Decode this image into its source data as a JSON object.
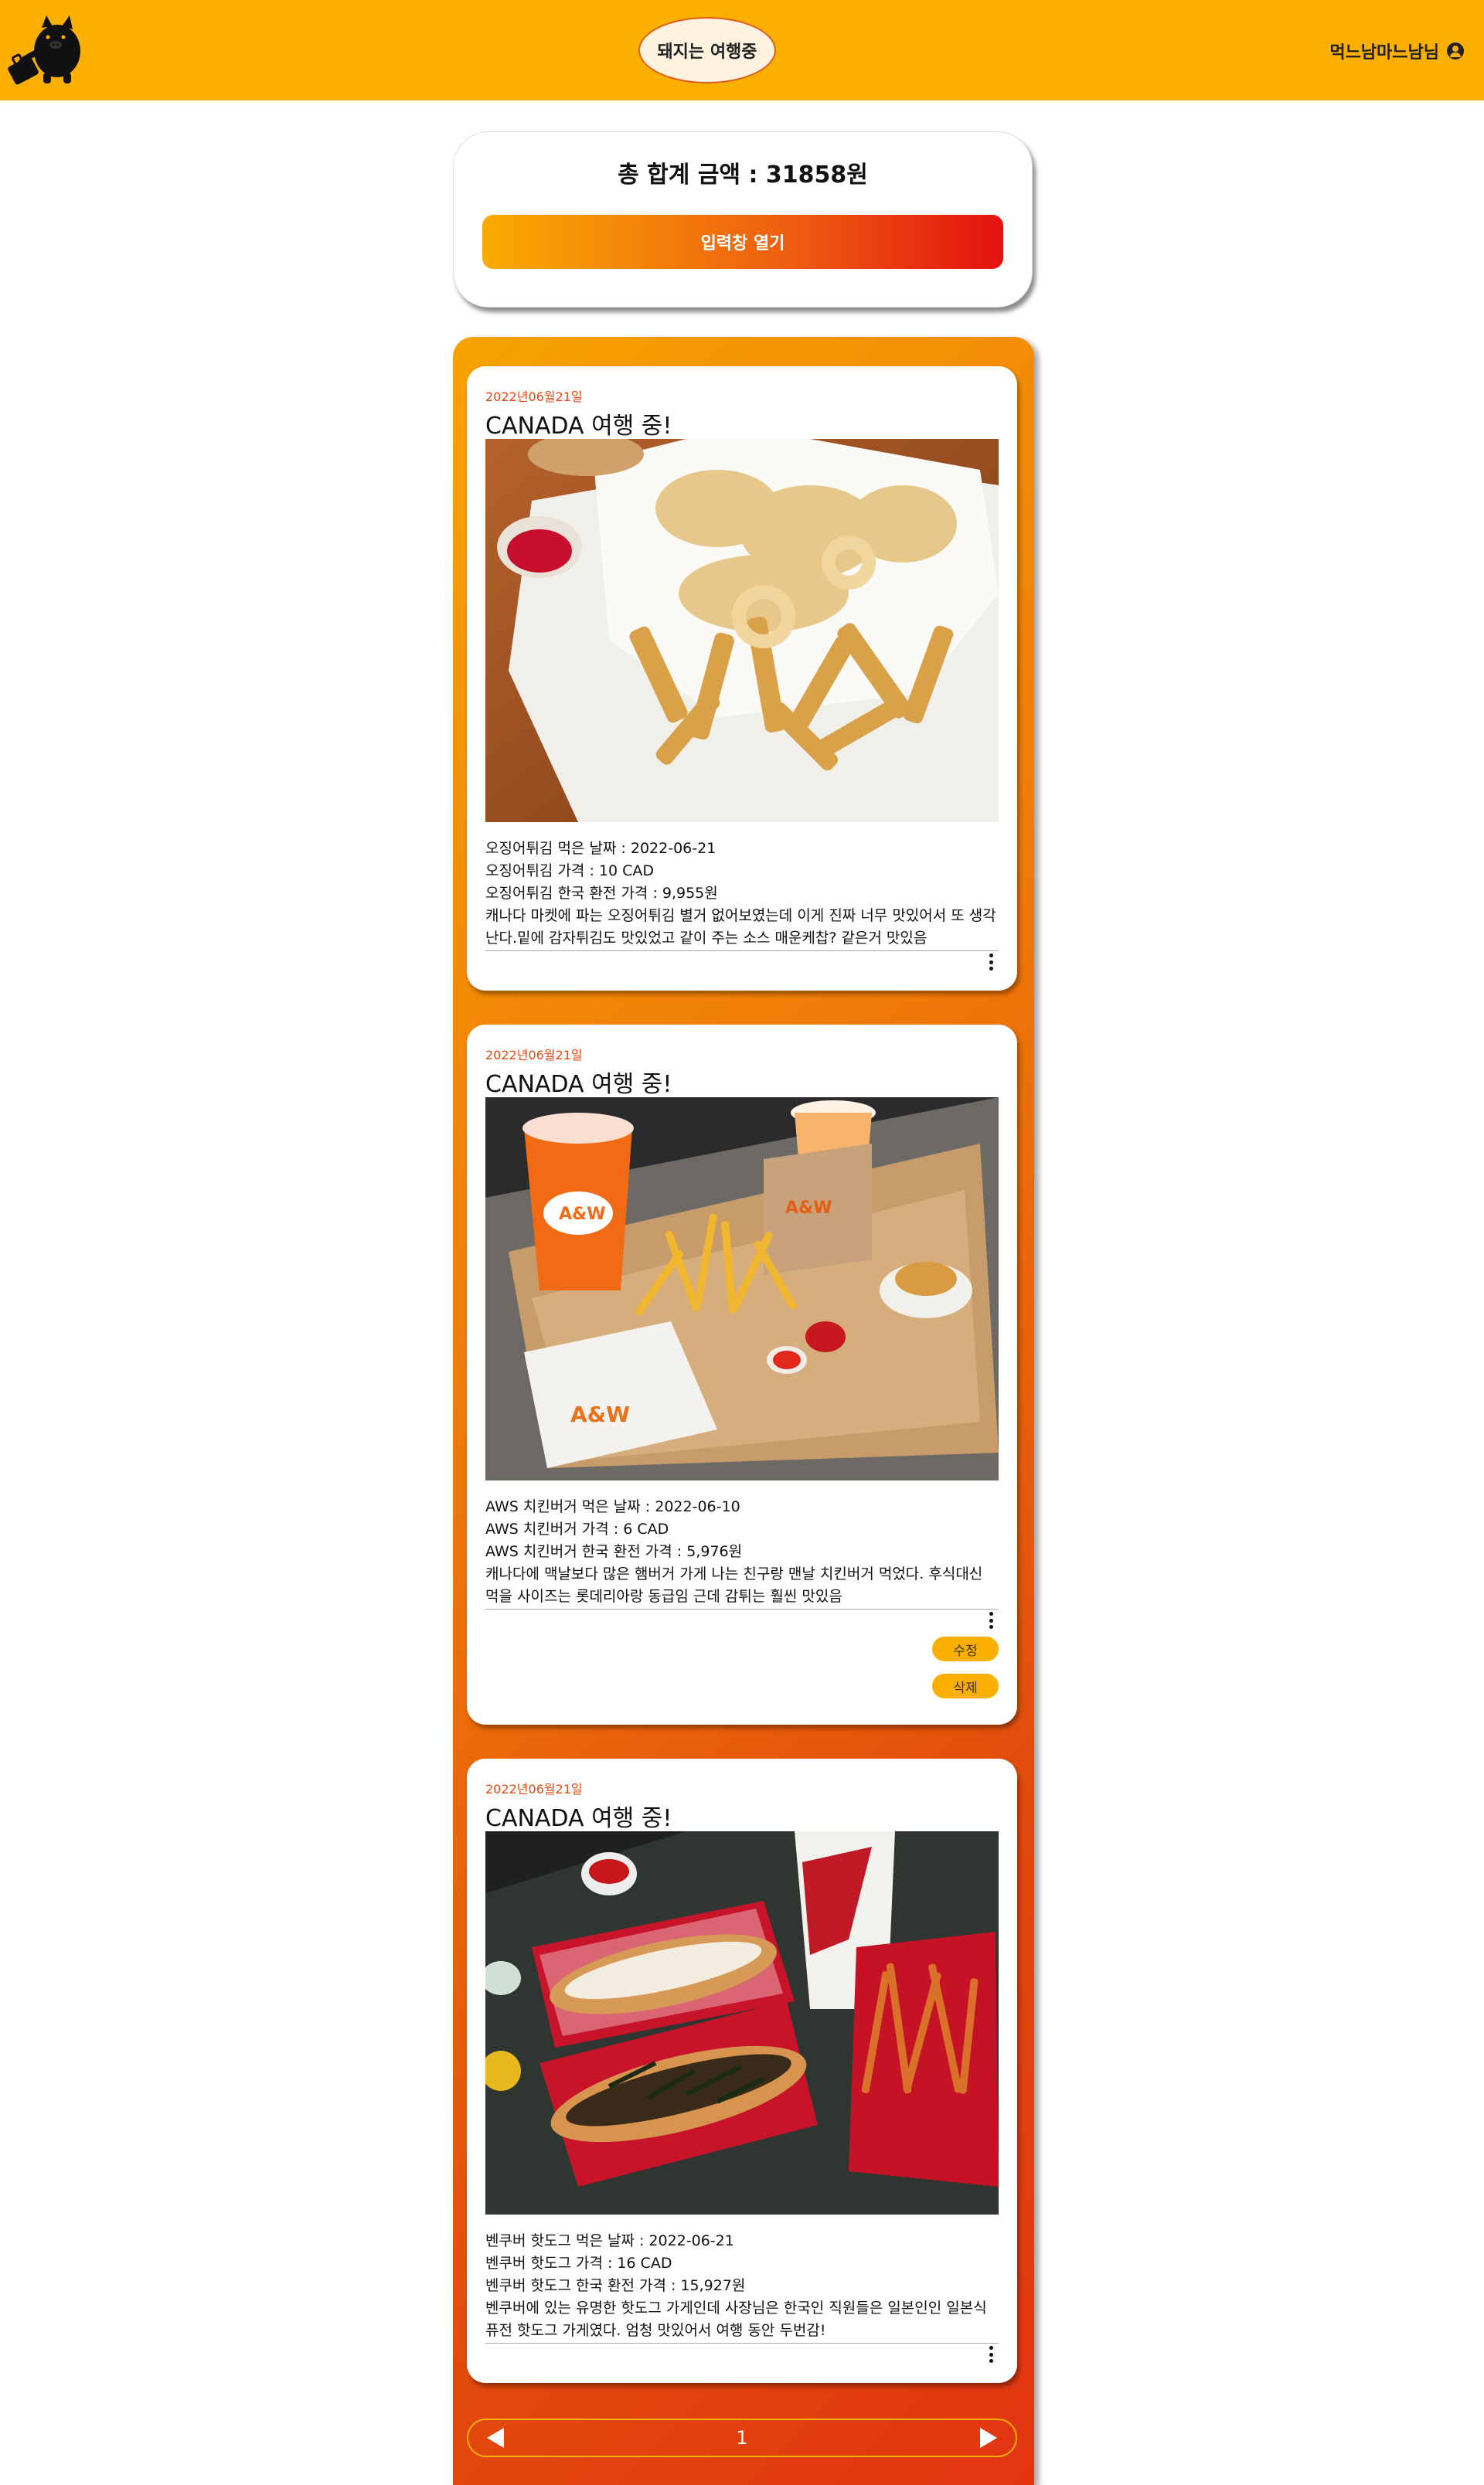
{
  "header": {
    "brand": "돼지는 여행중",
    "user_name": "먹느남마느남님",
    "logo_icon": "pig-traveler-logo-icon",
    "user_icon": "user-circle-icon"
  },
  "summary": {
    "total_label": "총 합계 금액 : 31858원",
    "open_button": "입력창 열기"
  },
  "posts": [
    {
      "date": "2022년06월21일",
      "title": "CANADA 여행 중!",
      "photo": "fried-squid-and-fries-photo",
      "lines": [
        "오징어튀김 먹은 날짜 : 2022-06-21",
        "오징어튀김 가격 : 10 CAD",
        "오징어튀김 한국 환전 가격 : 9,955원",
        "캐나다 마켓에 파는 오징어튀김 별거 없어보였는데 이게 진짜 너무 맛있어서 또 생각난다.밑에 감자튀김도 맛있었고 같이 주는 소스 매운케찹? 같은거 맛있음"
      ]
    },
    {
      "date": "2022년06월21일",
      "title": "CANADA 여행 중!",
      "photo": "aw-burger-meal-photo",
      "lines": [
        "AWS 치킨버거 먹은 날짜 : 2022-06-10",
        "AWS 치킨버거 가격 : 6 CAD",
        "AWS 치킨버거 한국 환전 가격 : 5,976원",
        "캐나다에 맥날보다 많은 햄버거 가게 나는 친구랑 맨날 치킨버거 먹었다. 후식대신 먹을 사이즈는 롯데리아랑 동급임 근데 감튀는 훨씬 맛있음"
      ],
      "edit_label": "수정",
      "delete_label": "삭제"
    },
    {
      "date": "2022년06월21일",
      "title": "CANADA 여행 중!",
      "photo": "vancouver-hotdog-photo",
      "lines": [
        "벤쿠버 핫도그 먹은 날짜 : 2022-06-21",
        "벤쿠버 핫도그 가격 : 16 CAD",
        "벤쿠버 핫도그 한국 환전 가격 : 15,927원",
        "벤쿠버에 있는 유명한 핫도그 가게인데 사장님은 한국인 직원들은 일본인인 일본식 퓨전 핫도그 가게였다. 엄청 맛있어서 여행 동안 두번감!"
      ]
    }
  ],
  "pagination": {
    "current_page": "1",
    "prev_icon": "triangle-left-icon",
    "next_icon": "triangle-right-icon"
  },
  "colors": {
    "brand_yellow": "#fbb000",
    "accent_orange": "#e5470f",
    "gradient_red": "#e3120f"
  }
}
